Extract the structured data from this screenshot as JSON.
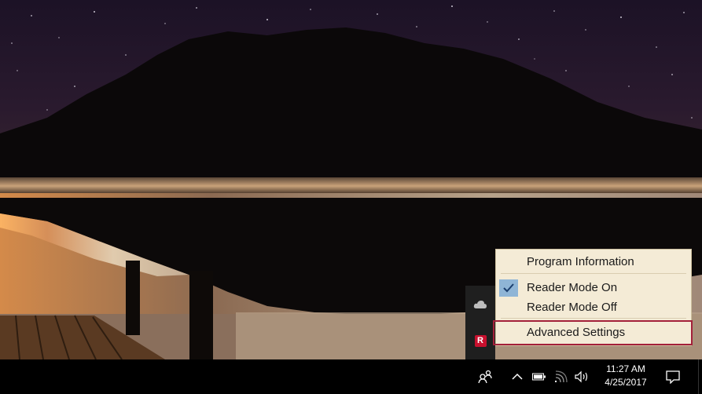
{
  "tray_overflow": {
    "icons": [
      "cloud-icon",
      "reader-mode-app-icon"
    ],
    "reader_badge": "R",
    "reader_badge_color": "#c8102e"
  },
  "context_menu": {
    "items": [
      {
        "label": "Program Information",
        "checked": false
      },
      {
        "label": "Reader Mode On",
        "checked": true
      },
      {
        "label": "Reader Mode Off",
        "checked": false
      },
      {
        "label": "Advanced Settings",
        "checked": false,
        "highlighted": true
      }
    ],
    "background": "#f4ebd6",
    "check_color": "#8fb5d6",
    "highlight_color": "#a3203a"
  },
  "taskbar": {
    "tray_icons": [
      "people-icon",
      "chevron-up-icon",
      "battery-icon",
      "network-icon",
      "volume-icon",
      "notification-icon"
    ],
    "clock": {
      "time": "11:27 AM",
      "date": "4/25/2017"
    }
  }
}
